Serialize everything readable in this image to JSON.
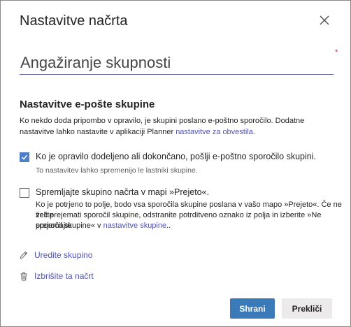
{
  "dialog": {
    "title": "Nastavitve načrta",
    "close_icon": "close-icon",
    "required_marker": "*"
  },
  "plan_name": {
    "value": "Angažiranje skupnosti"
  },
  "email_settings": {
    "heading": "Nastavitve e-pošte skupine",
    "description": "Ko nekdo doda pripombo v opravilo, je skupini poslano e-poštno sporočilo. Dodatne nastavitve lahko nastavite v aplikaciji Planner ",
    "description_link": "nastavitve za obvestila",
    "description_end": ".",
    "option1": {
      "checked": true,
      "label": "Ko je opravilo dodeljeno ali dokončano, pošlji e-poštno sporočilo skupini.",
      "hint": "To nastavitev lahko spremenijo le lastniki skupine."
    },
    "option2": {
      "checked": false,
      "label": "Spremljajte skupino načrta v mapi »Prejeto«.",
      "desc_line1": "Ko je potrjeno to polje, bodo vsa sporočila skupine poslana v vašo mapo »Prejeto«. Če ne želite",
      "desc_line2": "več prejemati sporočil skupine, odstranite potrditveno oznako iz polja in izberite »Ne prejemajte",
      "desc_line3_start": "sporočil skupine« v ",
      "desc_link": "nastavitve skupine",
      "desc_line3_end": ".."
    }
  },
  "actions": {
    "edit_group": {
      "label": "Uredite skupino",
      "icon": "pencil-icon"
    },
    "delete_plan": {
      "label": "Izbrišite ta načrt",
      "icon": "trash-icon"
    }
  },
  "footer": {
    "save_label": "Shrani",
    "cancel_label": "Prekliči"
  },
  "colors": {
    "accent": "#4f52b2",
    "primary_button": "#3a7ab8",
    "checkbox_checked": "#4f7fc9",
    "required": "#c4314b"
  }
}
